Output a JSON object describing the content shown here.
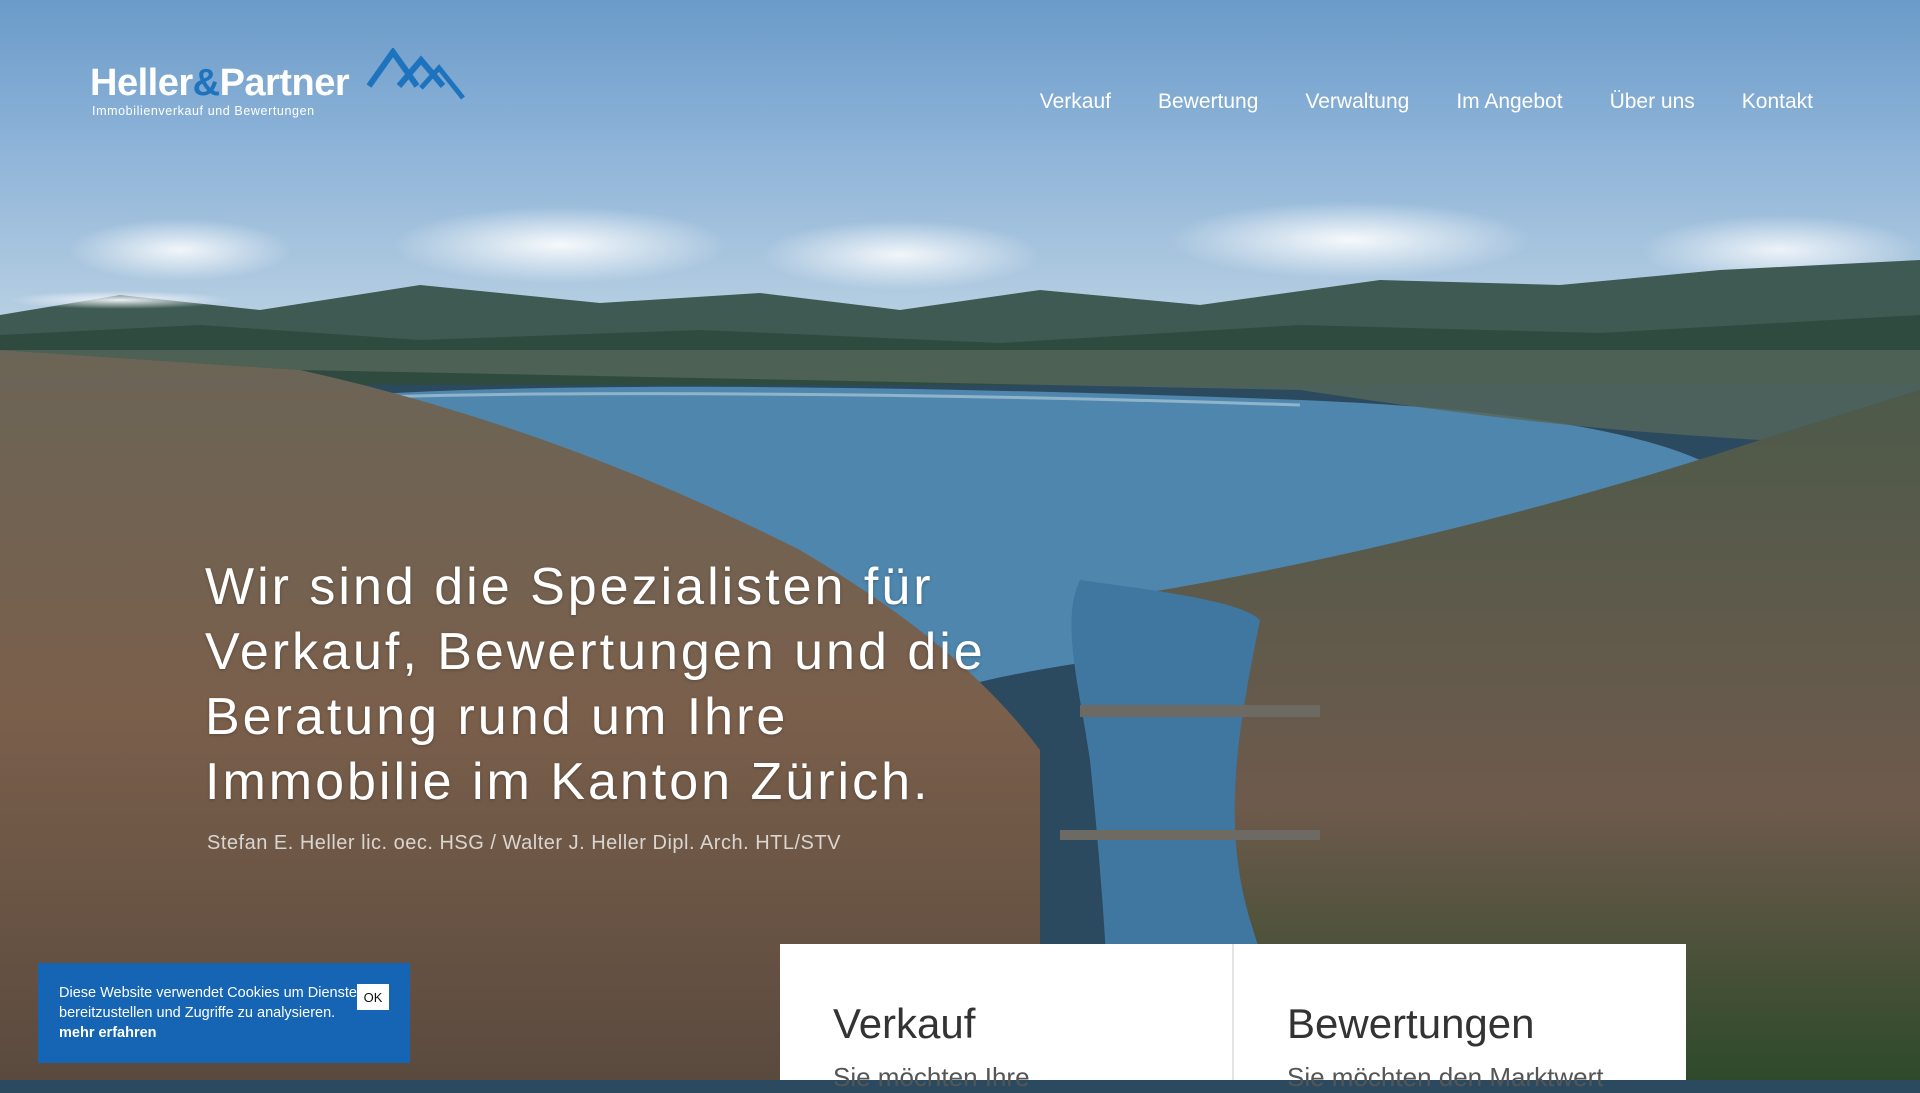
{
  "brand": {
    "name_part1": "Heller",
    "name_amp": "&",
    "name_part2": "Partner",
    "tagline": "Immobilienverkauf und Bewertungen",
    "primary_color": "#1e73be",
    "logo_icon": "mountain-peaks-icon"
  },
  "nav": {
    "items": [
      {
        "label": "Verkauf"
      },
      {
        "label": "Bewertung"
      },
      {
        "label": "Verwaltung"
      },
      {
        "label": "Im Angebot"
      },
      {
        "label": "Über uns"
      },
      {
        "label": "Kontakt"
      }
    ]
  },
  "hero": {
    "headline": "Wir sind die Spezialisten für Verkauf, Bewertungen und die Beratung rund um Ihre Immobilie im Kanton Zürich.",
    "credit": "Stefan E. Heller lic. oec. HSG / Walter J. Heller Dipl. Arch. HTL/STV"
  },
  "cards": [
    {
      "title": "Verkauf",
      "text": "Sie möchten Ihre"
    },
    {
      "title": "Bewertungen",
      "text": "Sie möchten den Marktwert"
    }
  ],
  "cookie": {
    "text": "Diese Website verwendet Cookies um Dienste bereitzustellen und Zugriffe zu analysieren.",
    "link_label": "mehr erfahren",
    "ok_label": "OK",
    "background_color": "#1665b4"
  }
}
